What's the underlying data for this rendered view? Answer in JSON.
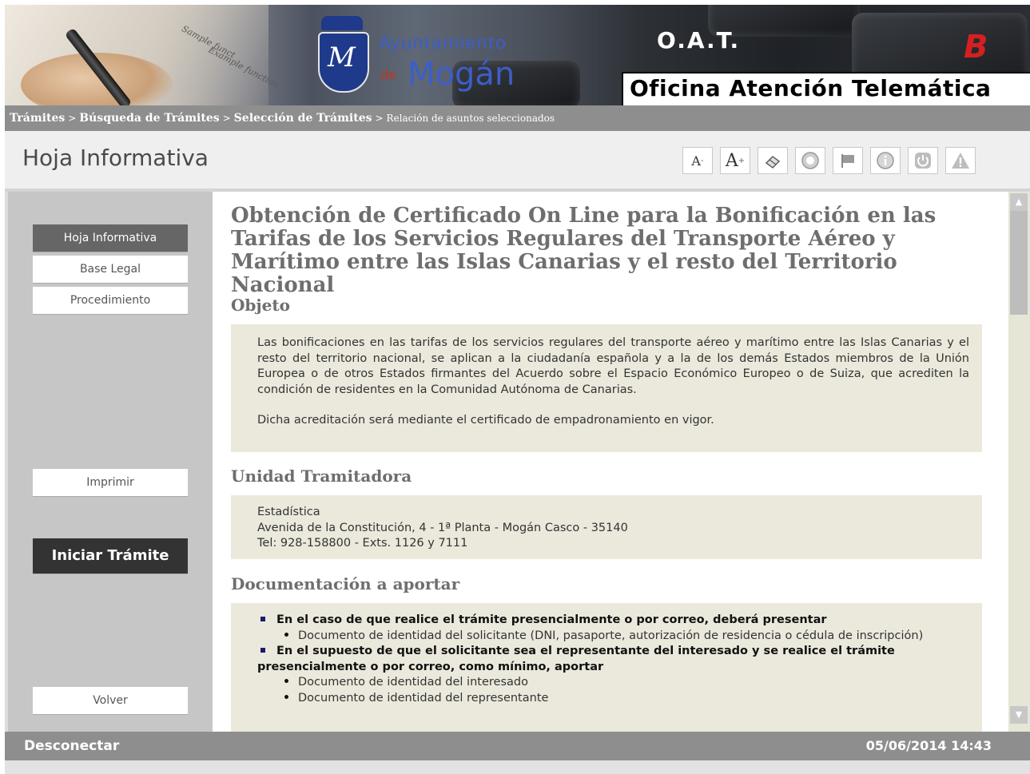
{
  "banner": {
    "org_line1": "Ayuntamiento",
    "org_line2_prefix": "de",
    "org_line2": "Mogán",
    "ort": "O.A.T.",
    "office": "Oficina Atención Telemática",
    "paper_text_1": "Sample funct",
    "paper_text_2": "Example function"
  },
  "breadcrumb": {
    "items": [
      "Trámites",
      "Búsqueda de Trámites",
      "Selección de Trámites"
    ],
    "separator": ">",
    "current": "Relación de asuntos seleccionados"
  },
  "header": {
    "title": "Hoja Informativa",
    "toolbar": {
      "decrease_font": "A",
      "decrease_sup": "-",
      "increase_font": "A",
      "increase_sup": "+"
    }
  },
  "sidebar": {
    "tabs": [
      "Hoja Informativa",
      "Base Legal",
      "Procedimiento"
    ],
    "print": "Imprimir",
    "start": "Iniciar Trámite",
    "back": "Volver"
  },
  "content": {
    "title": "Obtención de Certificado On Line para la Bonificación en las Tarifas de los Servicios Regulares del Transporte Aéreo y Marítimo entre las Islas Canarias y el resto del Territorio Nacional",
    "objeto": {
      "heading": "Objeto",
      "p1": "Las bonificaciones en las tarifas de los servicios regulares del transporte aéreo y marítimo entre las Islas Canarias y el resto del territorio nacional, se aplican a la ciudadanía española y a la de los demás Estados miembros de la Unión Europea o de otros Estados firmantes del Acuerdo sobre el Espacio Económico Europeo o de Suiza, que acrediten la condición de residentes en la Comunidad Autónoma de Canarias.",
      "p2": "Dicha acreditación será mediante el certificado de empadronamiento en vigor."
    },
    "unidad": {
      "heading": "Unidad Tramitadora",
      "line1": "Estadística",
      "line2": "Avenida de la Constitución, 4 - 1ª Planta - Mogán Casco -  35140",
      "line3": "Tel: 928-158800 - Exts. 1126 y 7111"
    },
    "documentacion": {
      "heading": "Documentación a aportar",
      "group1_title": "En el caso de que realice el trámite presencialmente o por correo, deberá presentar",
      "group1_item1": "Documento de identidad del solicitante (DNI, pasaporte, autorización de residencia o cédula de inscripción)",
      "group2_title": "En el supuesto de que el solicitante sea el representante del interesado y se realice el trámite presencialmente o por correo, como mínimo, aportar",
      "group2_item1": "Documento de identidad del interesado",
      "group2_item2": "Documento de identidad del representante"
    }
  },
  "footer": {
    "disconnect": "Desconectar",
    "datetime": "05/06/2014 14:43"
  },
  "scrollbar": {
    "position": 0.0
  }
}
